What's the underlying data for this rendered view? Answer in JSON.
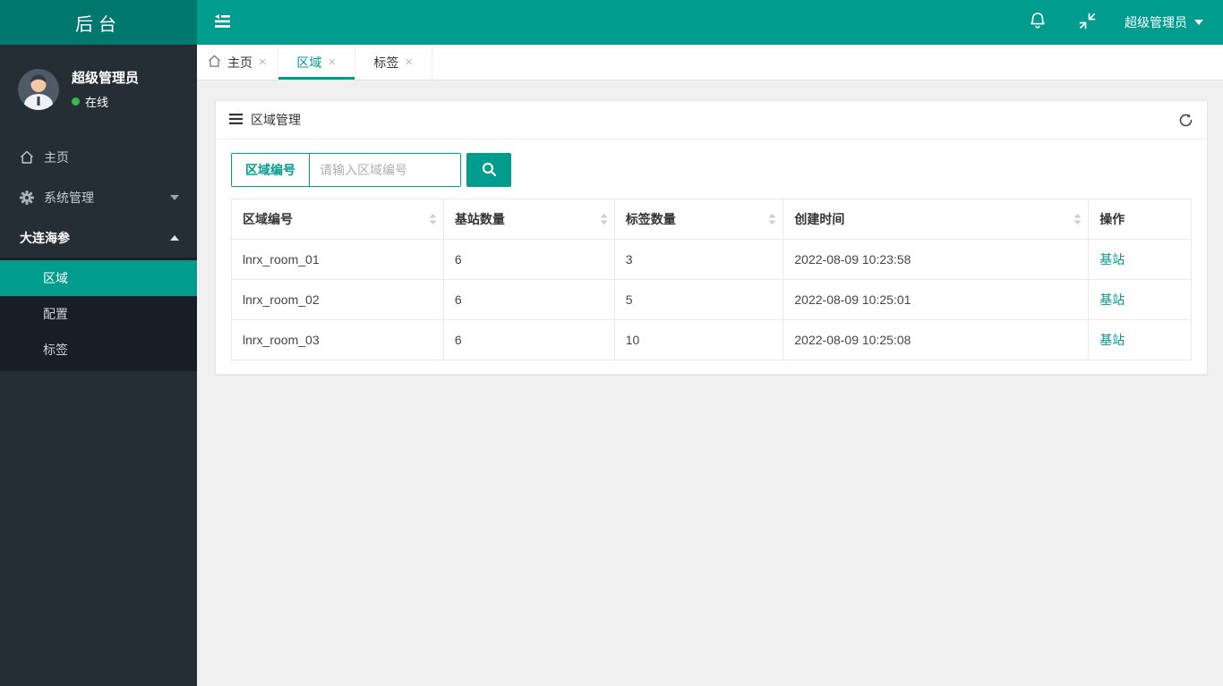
{
  "header": {
    "logo": "后台",
    "user_menu_label": "超级管理员"
  },
  "sidebar": {
    "user": {
      "name": "超级管理员",
      "status": "在线"
    },
    "menu": [
      {
        "label": "主页"
      },
      {
        "label": "系统管理"
      },
      {
        "label": "大连海参"
      }
    ],
    "submenu": [
      {
        "label": "区域"
      },
      {
        "label": "配置"
      },
      {
        "label": "标签"
      }
    ]
  },
  "tabs": [
    {
      "label": "主页"
    },
    {
      "label": "区域"
    },
    {
      "label": "标签"
    }
  ],
  "panel": {
    "title": "区域管理",
    "search_label": "区域编号",
    "search_placeholder": "请输入区域编号"
  },
  "table": {
    "columns": [
      "区域编号",
      "基站数量",
      "标签数量",
      "创建时间",
      "操作"
    ],
    "rows": [
      [
        "lnrx_room_01",
        "6",
        "3",
        "2022-08-09 10:23:58",
        "基站"
      ],
      [
        "lnrx_room_02",
        "6",
        "5",
        "2022-08-09 10:25:01",
        "基站"
      ],
      [
        "lnrx_room_03",
        "6",
        "10",
        "2022-08-09 10:25:08",
        "基站"
      ]
    ]
  },
  "colors": {
    "teal": "#009c8e",
    "teal_dark": "#00786d",
    "sidebar_bg": "#252d35",
    "submenu_bg": "#171e25",
    "online_green": "#3db84a",
    "page_bg": "#f0f0f0"
  }
}
